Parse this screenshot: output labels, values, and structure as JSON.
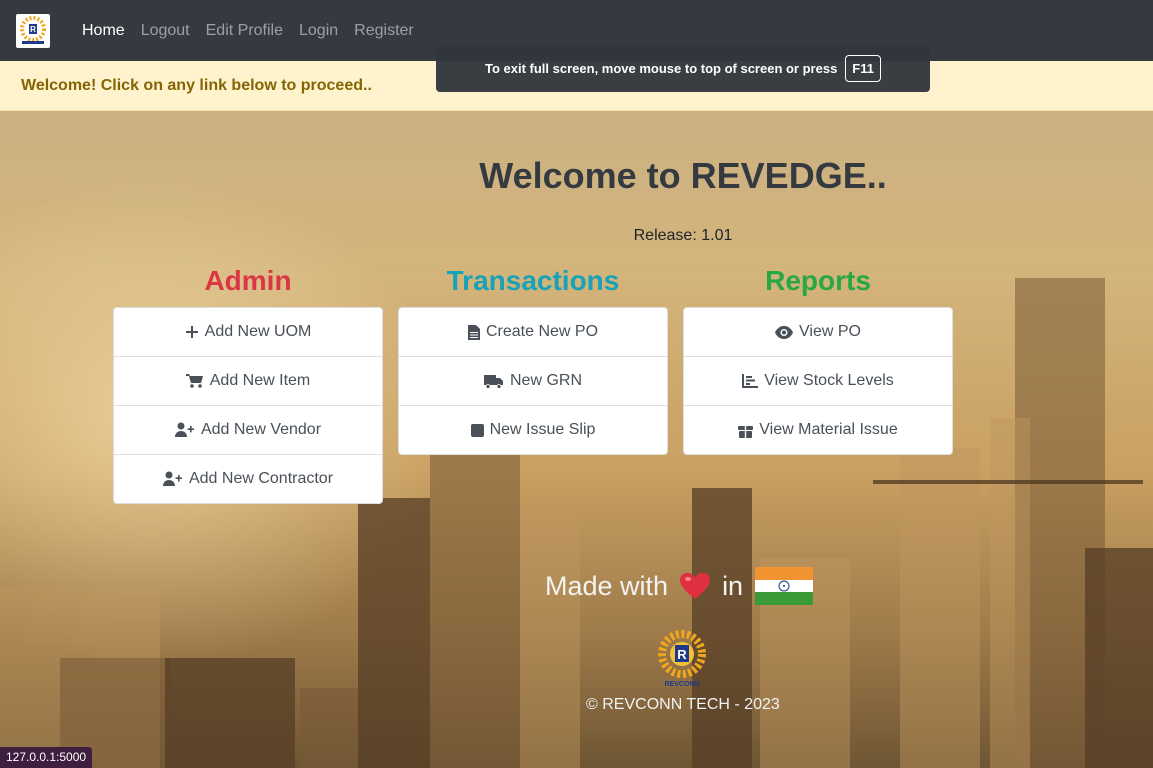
{
  "nav": {
    "links": [
      "Home",
      "Logout",
      "Edit Profile",
      "Login",
      "Register"
    ]
  },
  "fullscreen_notice": {
    "text": "To exit full screen, move mouse to top of screen or press",
    "key": "F11"
  },
  "alert": {
    "text": "Welcome! Click on any link below to proceed.."
  },
  "heading": "Welcome to REVEDGE..",
  "release": "Release: 1.01",
  "sections": {
    "admin": {
      "title": "Admin",
      "items": [
        {
          "icon": "plus-icon",
          "label": "Add New UOM"
        },
        {
          "icon": "cart-icon",
          "label": "Add New Item"
        },
        {
          "icon": "user-plus-icon",
          "label": "Add New Vendor"
        },
        {
          "icon": "user-plus-icon",
          "label": "Add New Contractor"
        }
      ]
    },
    "transactions": {
      "title": "Transactions",
      "items": [
        {
          "icon": "file-icon",
          "label": "Create New PO"
        },
        {
          "icon": "truck-icon",
          "label": "New GRN"
        },
        {
          "icon": "square-icon",
          "label": "New Issue Slip"
        }
      ]
    },
    "reports": {
      "title": "Reports",
      "items": [
        {
          "icon": "eye-icon",
          "label": "View PO"
        },
        {
          "icon": "bar-chart-icon",
          "label": "View Stock Levels"
        },
        {
          "icon": "gift-icon",
          "label": "View Material Issue"
        }
      ]
    }
  },
  "footer": {
    "made_with": "Made with",
    "in": "in",
    "copyright": "© REVCONN TECH - 2023",
    "logo_text": "REVCONN"
  },
  "status_url": "127.0.0.1:5000",
  "colors": {
    "navbar": "#343a40",
    "admin": "#dc3545",
    "transactions": "#17a2b8",
    "reports": "#28a745",
    "alert_bg": "#fff3cd",
    "alert_text": "#856404"
  }
}
